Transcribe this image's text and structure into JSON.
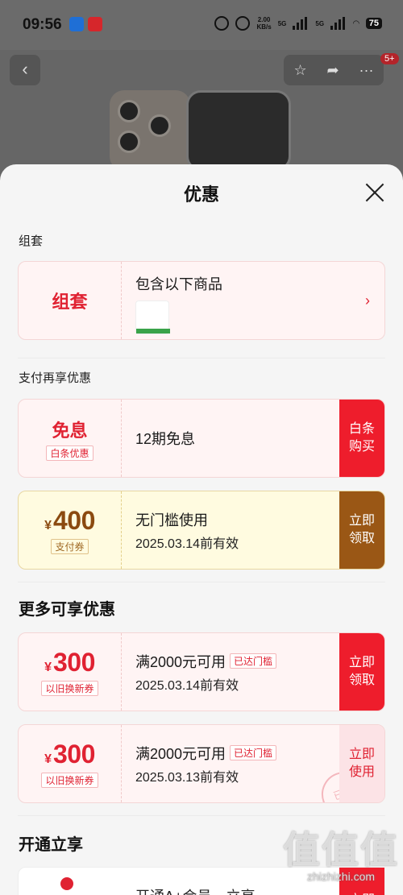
{
  "status_bar": {
    "time": "09:56",
    "net_speed": "2.00",
    "net_unit": "KB/s",
    "signal1": "5G",
    "signal2": "5G",
    "battery": "75"
  },
  "header": {
    "back_icon": "chevron-left-icon",
    "badge": "5+"
  },
  "sheet": {
    "title": "优惠",
    "sections": {
      "bundle": {
        "label": "组套",
        "left_title": "组套",
        "text": "包含以下商品"
      },
      "payment": {
        "label": "支付再享优惠",
        "interest_free": {
          "title": "免息",
          "tag": "白条优惠",
          "text": "12期免息",
          "action_line1": "白条",
          "action_line2": "购买"
        },
        "coupon": {
          "currency": "¥",
          "amount": "400",
          "tag": "支付券",
          "text": "无门槛使用",
          "valid": "2025.03.14前有效",
          "action_line1": "立即",
          "action_line2": "领取"
        }
      },
      "more": {
        "label": "更多可享优惠",
        "coupons": [
          {
            "currency": "¥",
            "amount": "300",
            "tag": "以旧换新券",
            "text": "满2000元可用",
            "threshold": "已达门槛",
            "valid": "2025.03.14前有效",
            "action_line1": "立即",
            "action_line2": "领取"
          },
          {
            "currency": "¥",
            "amount": "300",
            "tag": "以旧换新券",
            "text": "满2000元可用",
            "threshold": "已达门槛",
            "valid": "2025.03.13前有效",
            "action_line1": "立即",
            "action_line2": "使用",
            "stamp": "已领"
          }
        ]
      },
      "vip": {
        "label": "开通立享",
        "text": "开通A+会员，立享",
        "action": "立即"
      }
    }
  },
  "watermark": {
    "glyphs": "值值值",
    "url": "zhizhizhi.com"
  },
  "colors": {
    "accent": "#ee1d2c",
    "coupon_brown": "#9a5715",
    "card_pink": "#fff4f4",
    "card_yellow": "#fffbe0"
  }
}
